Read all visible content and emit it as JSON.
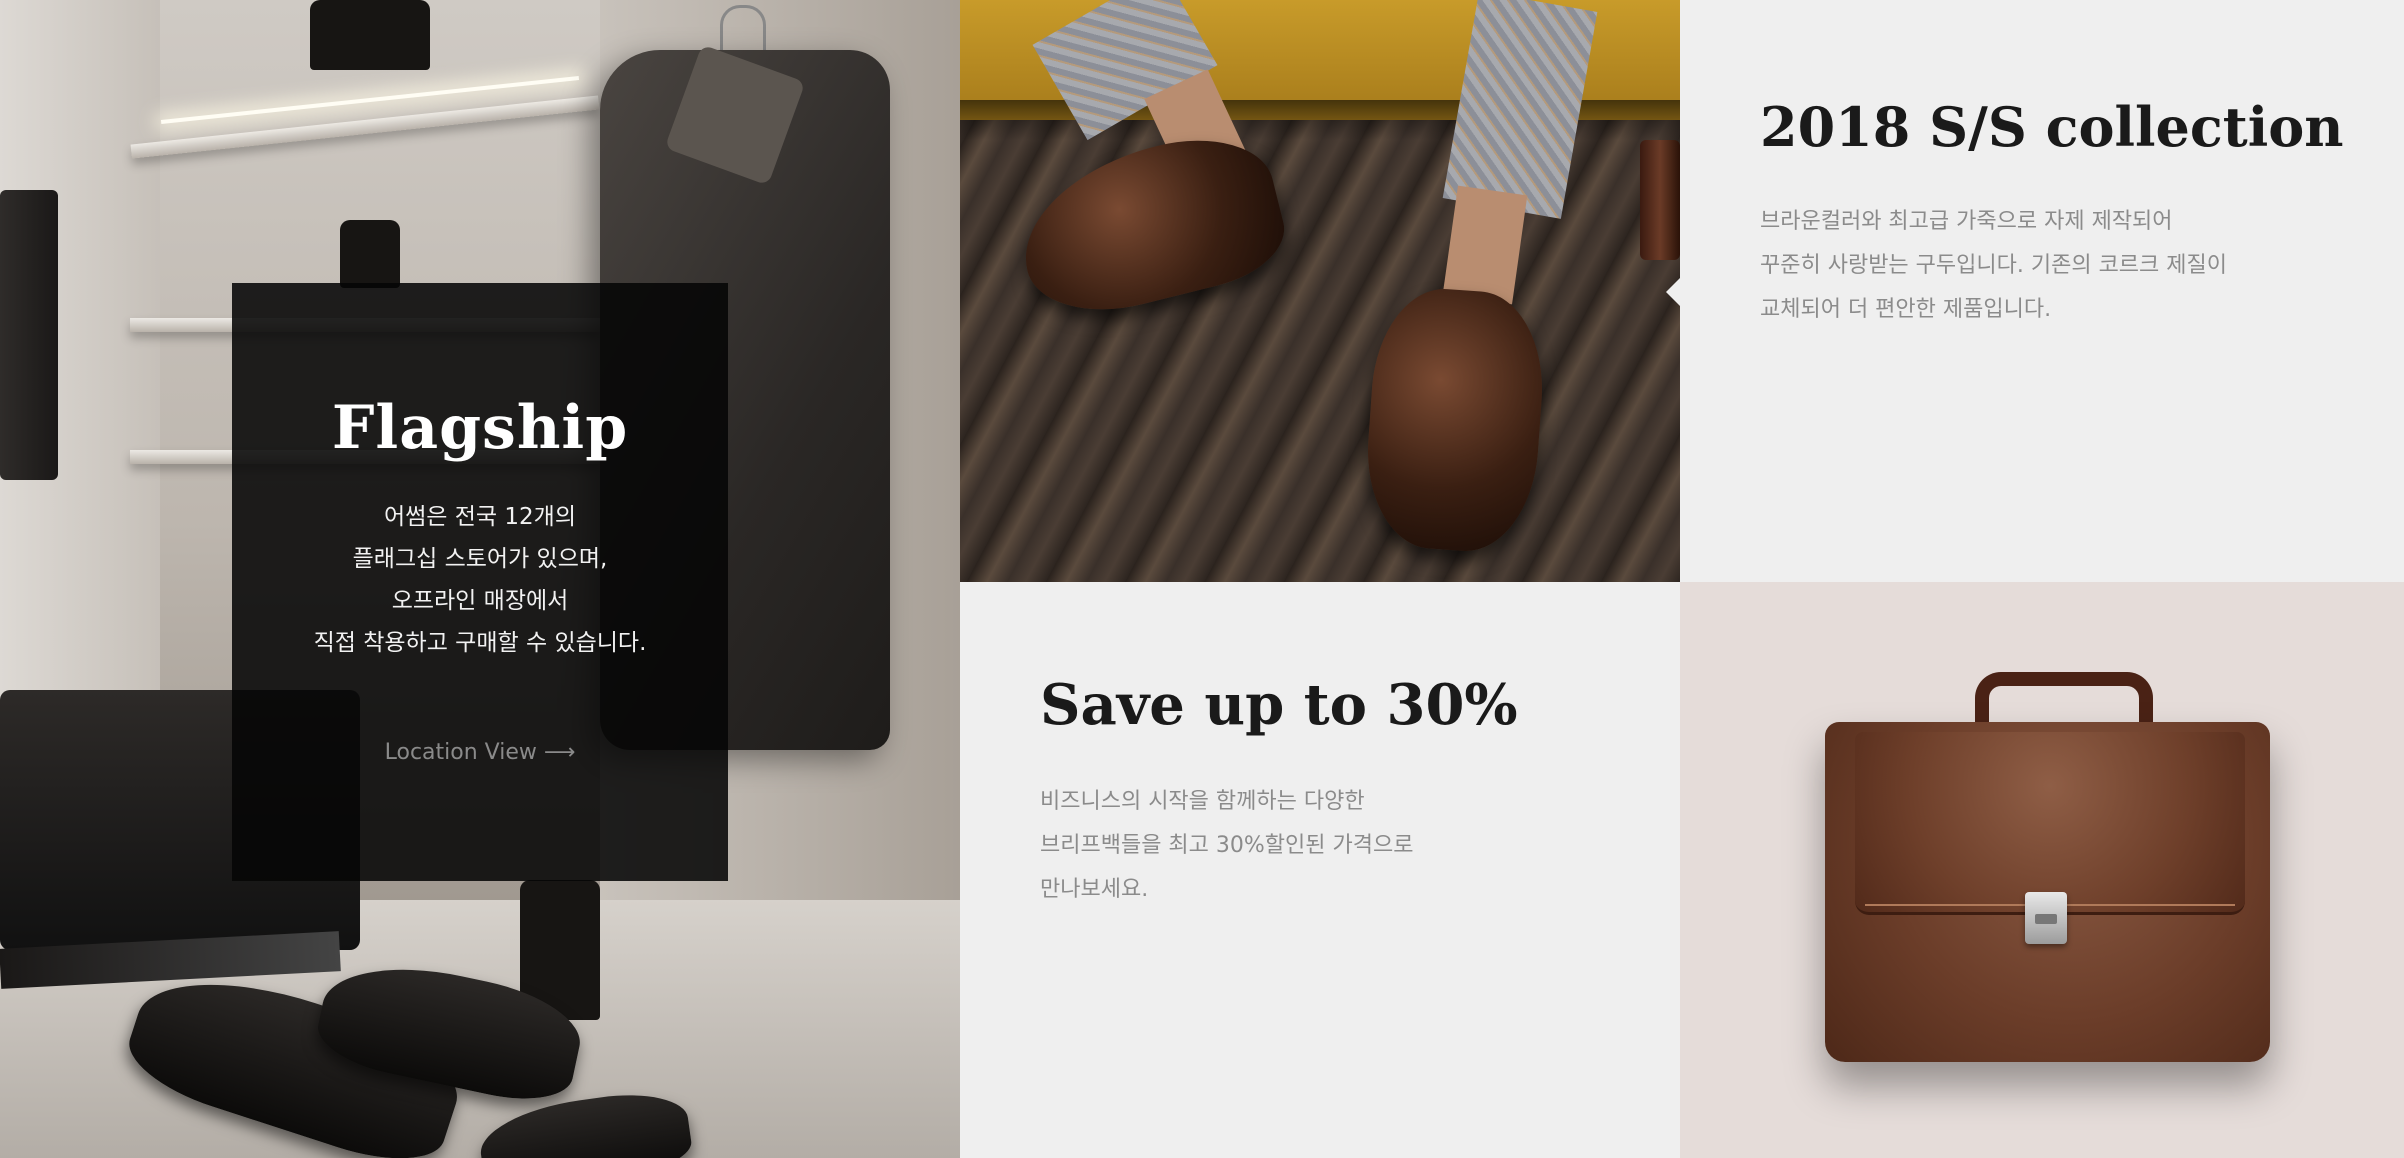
{
  "flagship": {
    "title": "Flagship",
    "lines": [
      "어썸은 전국 12개의",
      "플래그십 스토어가 있으며,",
      "오프라인 매장에서",
      "직접 착용하고 구매할 수 있습니다."
    ],
    "link_label": "Location View ⟶"
  },
  "collection": {
    "title": "2018 S/S collection",
    "lines": [
      "브라운컬러와 최고급 가죽으로 자제 제작되어",
      "꾸준히 사랑받는 구두입니다. 기존의 코르크 제질이",
      "교체되어 더 편안한 제품입니다."
    ]
  },
  "sale": {
    "title": "Save up to 30%",
    "lines": [
      "비즈니스의 시작을 함께하는 다양한",
      "브리프백들을 최고 30%할인된 가격으로",
      "만나보세요."
    ]
  },
  "colors": {
    "card_bg": "#efefef",
    "overlay": "#060606",
    "body_text": "#8b8b8b",
    "title_text": "#1a1a1a",
    "briefcase_bg": "#e5dcd9"
  }
}
